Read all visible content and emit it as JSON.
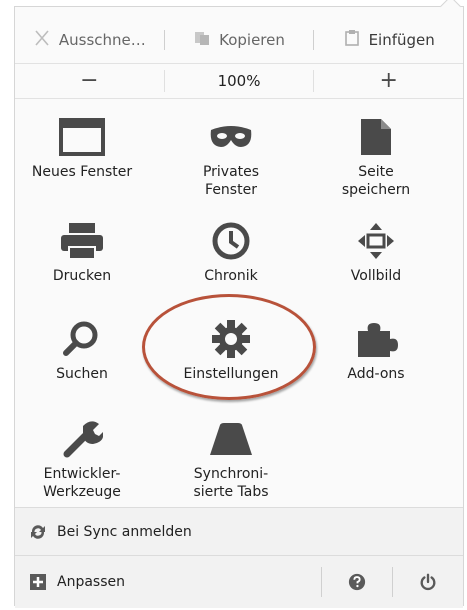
{
  "edit": {
    "cut_label": "Ausschne…",
    "copy_label": "Kopieren",
    "paste_label": "Einfügen"
  },
  "zoom": {
    "out_label": "−",
    "level": "100%",
    "in_label": "+"
  },
  "items": [
    {
      "label": "Neues Fenster",
      "icon": "window-icon"
    },
    {
      "label": "Privates\nFenster",
      "icon": "mask-icon"
    },
    {
      "label": "Seite\nspeichern",
      "icon": "page-icon"
    },
    {
      "label": "Drucken",
      "icon": "printer-icon"
    },
    {
      "label": "Chronik",
      "icon": "clock-icon"
    },
    {
      "label": "Vollbild",
      "icon": "fullscreen-icon"
    },
    {
      "label": "Suchen",
      "icon": "search-icon"
    },
    {
      "label": "Einstellungen",
      "icon": "gear-icon"
    },
    {
      "label": "Add-ons",
      "icon": "puzzle-icon"
    },
    {
      "label": "Entwickler-\nWerkzeuge",
      "icon": "wrench-icon"
    },
    {
      "label": "Synchroni-\nsierte Tabs",
      "icon": "tabs-icon"
    }
  ],
  "footer": {
    "sync_label": "Bei Sync anmelden",
    "customize_label": "Anpassen"
  },
  "colors": {
    "icon": "#4a4a4a",
    "highlight": "#b8523a",
    "footer_bg": "#f2f2f2"
  }
}
